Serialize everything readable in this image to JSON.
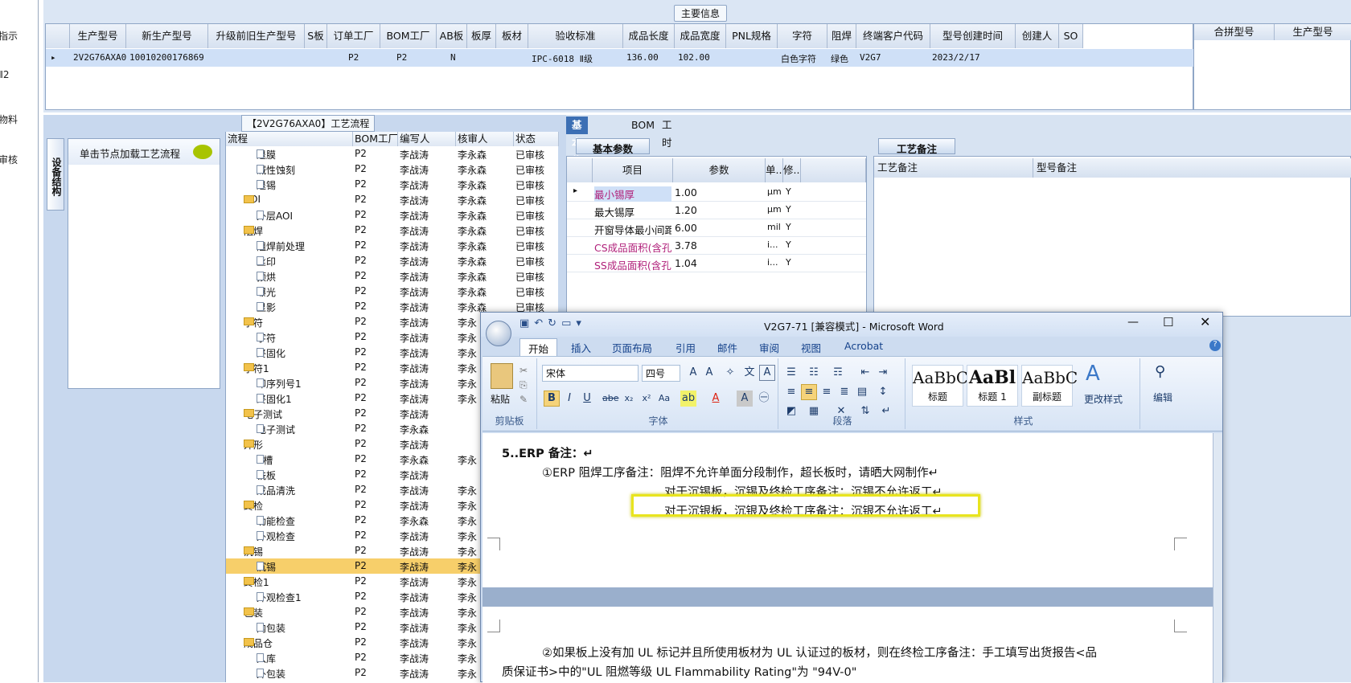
{
  "left_nav": [
    "指示",
    "Ⅱ2",
    "物料",
    "审核"
  ],
  "main_info": {
    "title": "主要信息",
    "columns": [
      "生产型号",
      "新生产型号",
      "升级前旧生产型号",
      "S板",
      "订单工厂",
      "BOM工厂",
      "AB板",
      "板厚",
      "板材",
      "验收标准",
      "成品长度",
      "成品宽度",
      "PNL规格",
      "字符",
      "阻焊",
      "终端客户代码",
      "型号创建时间",
      "创建人",
      "SO"
    ],
    "row": [
      "2V2G76AXA0",
      "10010200176869",
      "",
      "",
      "P2",
      "P2",
      "N",
      "",
      "",
      "IPC-6018 Ⅱ级",
      "136.00",
      "102.00",
      "",
      "白色字符",
      "绿色",
      "V2G7",
      "2023/2/17",
      "",
      ""
    ],
    "right_columns": [
      "合拼型号",
      "生产型号"
    ]
  },
  "process": {
    "title": "【2V2G76AXA0】工艺流程",
    "side_tab": "设备结构",
    "load_hint": "单击节点加载工艺流程",
    "columns": [
      "流程",
      "BOM工厂",
      "编写人",
      "核审人",
      "状态"
    ],
    "rows": [
      {
        "name": "退膜",
        "level": 2,
        "bom": "P2",
        "writer": "李战涛",
        "reviewer": "李永森",
        "status": "已审核"
      },
      {
        "name": "碱性蚀刻",
        "level": 2,
        "bom": "P2",
        "writer": "李战涛",
        "reviewer": "李永森",
        "status": "已审核"
      },
      {
        "name": "退锡",
        "level": 2,
        "bom": "P2",
        "writer": "李战涛",
        "reviewer": "李永森",
        "status": "已审核"
      },
      {
        "name": "AOI",
        "level": 1,
        "bom": "P2",
        "writer": "李战涛",
        "reviewer": "李永森",
        "status": "已审核"
      },
      {
        "name": "外层AOI",
        "level": 2,
        "bom": "P2",
        "writer": "李战涛",
        "reviewer": "李永森",
        "status": "已审核"
      },
      {
        "name": "阻焊",
        "level": 1,
        "bom": "P2",
        "writer": "李战涛",
        "reviewer": "李永森",
        "status": "已审核"
      },
      {
        "name": "阻焊前处理",
        "level": 2,
        "bom": "P2",
        "writer": "李战涛",
        "reviewer": "李永森",
        "status": "已审核"
      },
      {
        "name": "丝印",
        "level": 2,
        "bom": "P2",
        "writer": "李战涛",
        "reviewer": "李永森",
        "status": "已审核"
      },
      {
        "name": "预烘",
        "level": 2,
        "bom": "P2",
        "writer": "李战涛",
        "reviewer": "李永森",
        "status": "已审核"
      },
      {
        "name": "曝光",
        "level": 2,
        "bom": "P2",
        "writer": "李战涛",
        "reviewer": "李永森",
        "status": "已审核"
      },
      {
        "name": "显影",
        "level": 2,
        "bom": "P2",
        "writer": "李战涛",
        "reviewer": "李永森",
        "status": "已审核"
      },
      {
        "name": "字符",
        "level": 1,
        "bom": "P2",
        "writer": "李战涛",
        "reviewer": "李永",
        "status": ""
      },
      {
        "name": "字符",
        "level": 2,
        "bom": "P2",
        "writer": "李战涛",
        "reviewer": "李永",
        "status": ""
      },
      {
        "name": "终固化",
        "level": 2,
        "bom": "P2",
        "writer": "李战涛",
        "reviewer": "李永",
        "status": ""
      },
      {
        "name": "字符1",
        "level": 1,
        "bom": "P2",
        "writer": "李战涛",
        "reviewer": "李永",
        "status": ""
      },
      {
        "name": "印序列号1",
        "level": 2,
        "bom": "P2",
        "writer": "李战涛",
        "reviewer": "李永",
        "status": ""
      },
      {
        "name": "终固化1",
        "level": 2,
        "bom": "P2",
        "writer": "李战涛",
        "reviewer": "李永",
        "status": ""
      },
      {
        "name": "电子测试",
        "level": 1,
        "bom": "P2",
        "writer": "李战涛",
        "reviewer": "",
        "status": ""
      },
      {
        "name": "电子测试",
        "level": 2,
        "bom": "P2",
        "writer": "李永森",
        "reviewer": "",
        "status": ""
      },
      {
        "name": "外形",
        "level": 1,
        "bom": "P2",
        "writer": "李战涛",
        "reviewer": "",
        "status": ""
      },
      {
        "name": "V槽",
        "level": 2,
        "bom": "P2",
        "writer": "李永森",
        "reviewer": "李永",
        "status": ""
      },
      {
        "name": "铣板",
        "level": 2,
        "bom": "P2",
        "writer": "李战涛",
        "reviewer": "",
        "status": ""
      },
      {
        "name": "成品清洗",
        "level": 2,
        "bom": "P2",
        "writer": "李战涛",
        "reviewer": "李永",
        "status": ""
      },
      {
        "name": "终检",
        "level": 1,
        "bom": "P2",
        "writer": "李战涛",
        "reviewer": "李永",
        "status": ""
      },
      {
        "name": "功能检查",
        "level": 2,
        "bom": "P2",
        "writer": "李永森",
        "reviewer": "李永",
        "status": ""
      },
      {
        "name": "外观检查",
        "level": 2,
        "bom": "P2",
        "writer": "李战涛",
        "reviewer": "李永",
        "status": ""
      },
      {
        "name": "沉锡",
        "level": 1,
        "bom": "P2",
        "writer": "李战涛",
        "reviewer": "李永",
        "status": ""
      },
      {
        "name": "沉锡",
        "level": 2,
        "bom": "P2",
        "writer": "李战涛",
        "reviewer": "李永",
        "status": "",
        "selected": true
      },
      {
        "name": "终检1",
        "level": 1,
        "bom": "P2",
        "writer": "李战涛",
        "reviewer": "李永",
        "status": ""
      },
      {
        "name": "外观检查1",
        "level": 2,
        "bom": "P2",
        "writer": "李战涛",
        "reviewer": "李永",
        "status": ""
      },
      {
        "name": "包装",
        "level": 1,
        "bom": "P2",
        "writer": "李战涛",
        "reviewer": "李永",
        "status": ""
      },
      {
        "name": "内包装",
        "level": 2,
        "bom": "P2",
        "writer": "李战涛",
        "reviewer": "李永",
        "status": ""
      },
      {
        "name": "成品仓",
        "level": 1,
        "bom": "P2",
        "writer": "李战涛",
        "reviewer": "李永",
        "status": ""
      },
      {
        "name": "入库",
        "level": 2,
        "bom": "P2",
        "writer": "李战涛",
        "reviewer": "李永",
        "status": ""
      },
      {
        "name": "外包装",
        "level": 2,
        "bom": "P2",
        "writer": "李战涛",
        "reviewer": "李永",
        "status": ""
      }
    ]
  },
  "info_tabs": [
    "基本信息",
    "BOM",
    "工时"
  ],
  "basic_params": {
    "title": "基本参数",
    "columns": [
      "项目",
      "参数",
      "单...",
      "修..."
    ],
    "rows": [
      {
        "item": "最小锡厚",
        "value": "1.00",
        "unit": "μm",
        "mod": "Y",
        "highlight": true
      },
      {
        "item": "最大锡厚",
        "value": "1.20",
        "unit": "μm",
        "mod": "Y",
        "highlight": false
      },
      {
        "item": "开窗导体最小间距",
        "value": "6.00",
        "unit": "mil",
        "mod": "Y",
        "highlight": false
      },
      {
        "item": "CS成品面积(含孔)",
        "value": "3.78",
        "unit": "i...",
        "mod": "Y",
        "highlight": true
      },
      {
        "item": "SS成品面积(含孔)",
        "value": "1.04",
        "unit": "i...",
        "mod": "Y",
        "highlight": true
      }
    ]
  },
  "process_notes": {
    "title": "工艺备注",
    "columns": [
      "工艺备注",
      "型号备注"
    ]
  },
  "word": {
    "title": "V2G7-71 [兼容模式] - Microsoft Word",
    "tabs": [
      "开始",
      "插入",
      "页面布局",
      "引用",
      "邮件",
      "审阅",
      "视图",
      "Acrobat"
    ],
    "clipboard": {
      "paste": "粘贴",
      "label": "剪贴板"
    },
    "font": {
      "name": "宋体",
      "size": "四号",
      "label": "字体"
    },
    "paragraph_label": "段落",
    "styles": [
      {
        "preview": "AaBbC",
        "name": "标题"
      },
      {
        "preview": "AaBl",
        "name": "标题 1"
      },
      {
        "preview": "AaBbC",
        "name": "副标题"
      }
    ],
    "change_styles": "更改样式",
    "styles_label": "样式",
    "edit": "编辑",
    "doc_lines": {
      "heading": "5..ERP 备注：↵",
      "l1": "①ERP 阻焊工序备注：阻焊不允许单面分段制作，超长板时，请晒大网制作↵",
      "l2": "对于沉锡板，沉锡及终检工序备注：沉锡不允许返工↵",
      "l3": "对于沉银板，沉银及终检工序备注：沉银不允许返工↵",
      "l4": "②如果板上没有加 UL 标记并且所使用板材为 UL 认证过的板材，则在终检工序备注：手工填写出货报告<品",
      "l5": "质保证书>中的\"UL 阻燃等级 UL Flammability Rating\"为 \"94V-0\""
    }
  }
}
